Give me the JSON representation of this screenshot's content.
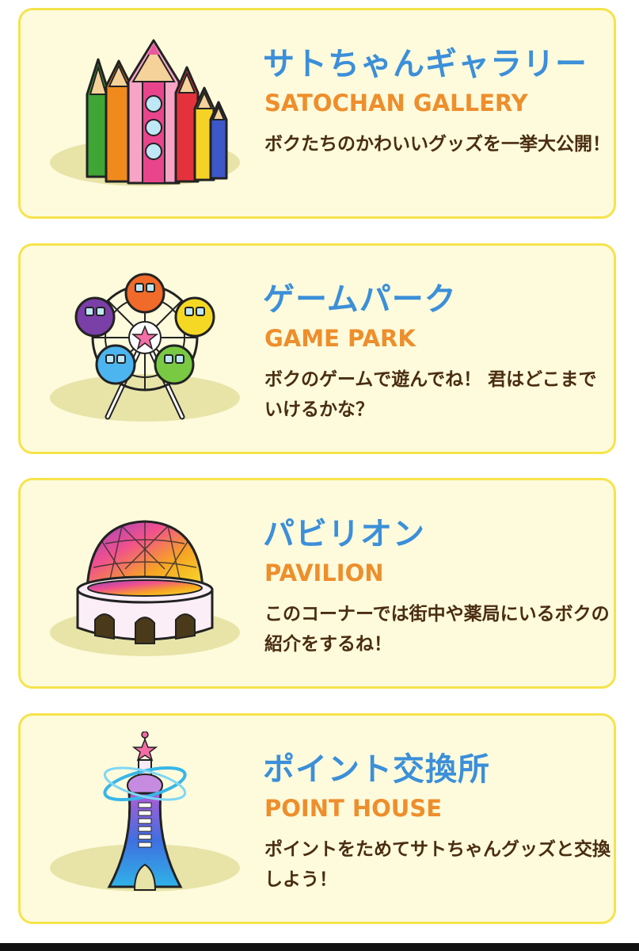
{
  "menu": {
    "items": [
      {
        "title": "サトちゃんギャラリー",
        "subtitle": "SATOCHAN GALLERY",
        "description": "ボクたちのかわいいグッズを一挙大公開！",
        "icon": "pencils-icon"
      },
      {
        "title": "ゲームパーク",
        "subtitle": "GAME PARK",
        "description": "ボクのゲームで遊んでね！ 君はどこまでいけるかな？",
        "icon": "ferris-wheel-icon"
      },
      {
        "title": "パビリオン",
        "subtitle": "PAVILION",
        "description": "このコーナーでは街中や薬局にいるボクの紹介をするね！",
        "icon": "dome-pavilion-icon"
      },
      {
        "title": "ポイント交換所",
        "subtitle": "POINT HOUSE",
        "description": "ポイントをためてサトちゃんグッズと交換しよう！",
        "icon": "tower-icon"
      }
    ]
  },
  "colors": {
    "title": "#3c8fd9",
    "subtitle": "#ee8e2c",
    "description": "#4a2d10",
    "card_background": "#fdfbdc",
    "card_border": "#f6e34a"
  }
}
